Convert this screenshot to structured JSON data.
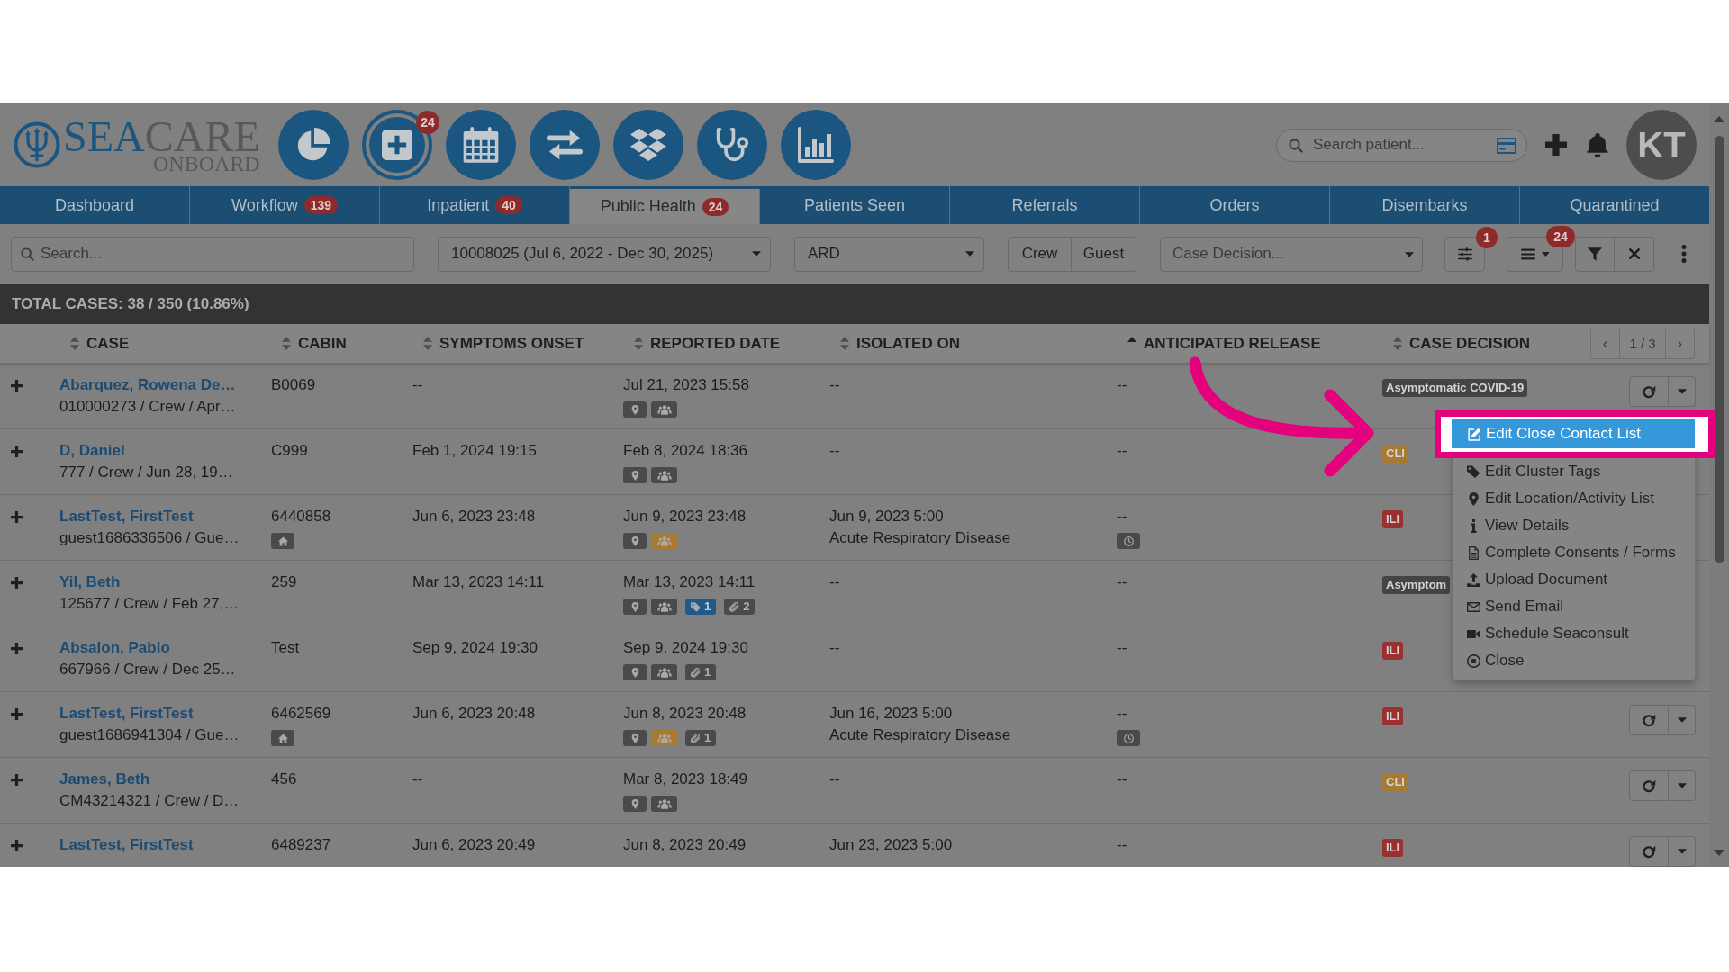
{
  "header": {
    "logo": {
      "primary": "SEA",
      "secondary": "CARE",
      "tagline": "ONBOARD"
    },
    "modules": [
      {
        "selected": false
      },
      {
        "selected": true,
        "badge": "24"
      },
      {
        "selected": false
      },
      {
        "selected": false
      },
      {
        "selected": false
      },
      {
        "selected": false
      },
      {
        "selected": false
      }
    ],
    "patient_search": {
      "placeholder": "Search patient..."
    },
    "avatar": {
      "initials": "KT"
    }
  },
  "tabs": [
    {
      "label": "Dashboard",
      "selected": false
    },
    {
      "label": "Workflow",
      "badge": "139",
      "selected": false
    },
    {
      "label": "Inpatient",
      "badge": "40",
      "selected": false
    },
    {
      "label": "Public Health",
      "badge": "24",
      "selected": true
    },
    {
      "label": "Patients Seen",
      "selected": false
    },
    {
      "label": "Referrals",
      "selected": false
    },
    {
      "label": "Orders",
      "selected": false
    },
    {
      "label": "Disembarks",
      "selected": false
    },
    {
      "label": "Quarantined",
      "selected": false
    }
  ],
  "filters": {
    "search": {
      "placeholder": "Search..."
    },
    "voyage": {
      "value": "10008025 (Jul 6, 2022 - Dec 30, 2025)"
    },
    "category": {
      "value": "ARD"
    },
    "population": [
      {
        "label": "Crew",
        "selected": false
      },
      {
        "label": "Guest",
        "selected": false
      }
    ],
    "case_decision": {
      "placeholder": "Case Decision..."
    },
    "settings_badge": "1",
    "list_badge": "24"
  },
  "summary": "TOTAL CASES: 38 / 350 (10.86%)",
  "table": {
    "columns": [
      {
        "label": "CASE",
        "sorted": false
      },
      {
        "label": "CABIN",
        "sorted": false
      },
      {
        "label": "SYMPTOMS ONSET",
        "sorted": false
      },
      {
        "label": "REPORTED DATE",
        "sorted": false
      },
      {
        "label": "ISOLATED ON",
        "sorted": false
      },
      {
        "label": "ANTICIPATED RELEASE",
        "sorted": true
      },
      {
        "label": "CASE DECISION",
        "sorted": false
      }
    ],
    "pager": {
      "prev": "‹",
      "label": "1 / 3",
      "next": "›"
    },
    "rows": [
      {
        "name": "Abarquez, Rowena De…",
        "details": "010000273 / Crew / Apr…",
        "cabin": "B0069",
        "cabin_home": false,
        "onset": "--",
        "reported": "Jul 21, 2023 15:58",
        "tags": [
          {
            "kind": "location",
            "color": "#4a4a4a"
          },
          {
            "kind": "group",
            "color": "#4a4a4a"
          }
        ],
        "isolated": "--",
        "release": "--",
        "release_timer": false,
        "decision": {
          "text": "Asymptomatic COVID-19",
          "color": "#444444"
        },
        "actions": true
      },
      {
        "name": "D, Daniel",
        "details": "777 / Crew / Jun 28, 19…",
        "cabin": "C999",
        "cabin_home": false,
        "onset": "Feb 1, 2024 19:15",
        "reported": "Feb 8, 2024 18:36",
        "tags": [
          {
            "kind": "location",
            "color": "#4a4a4a"
          },
          {
            "kind": "group",
            "color": "#4a4a4a"
          }
        ],
        "isolated": "--",
        "release": "--",
        "release_timer": false,
        "decision": {
          "text": "CLI",
          "color": "#a67a32"
        },
        "actions": false
      },
      {
        "name": "LastTest, FirstTest",
        "details": "guest1686336506 / Gue…",
        "cabin": "6440858",
        "cabin_home": true,
        "onset": "Jun 6, 2023 23:48",
        "reported": "Jun 9, 2023 23:48",
        "tags": [
          {
            "kind": "location",
            "color": "#4a4a4a"
          },
          {
            "kind": "group",
            "color": "#a67a32"
          }
        ],
        "isolated": "Jun 9, 2023 5:00",
        "isolated_reason": "Acute Respiratory Disease",
        "release": "--",
        "release_timer": true,
        "decision": {
          "text": "ILI",
          "color": "#9b3030"
        },
        "actions": false
      },
      {
        "name": "Yil, Beth",
        "details": "125677 / Crew / Feb 27,…",
        "cabin": "259",
        "cabin_home": false,
        "onset": "Mar 13, 2023 14:11",
        "reported": "Mar 13, 2023 14:11",
        "tags": [
          {
            "kind": "location",
            "color": "#4a4a4a"
          },
          {
            "kind": "group",
            "color": "#4a4a4a"
          },
          {
            "kind": "tag",
            "color": "#1f5a8a",
            "count": "1"
          },
          {
            "kind": "attachment",
            "color": "#4a4a4a",
            "count": "2"
          }
        ],
        "isolated": "--",
        "release": "--",
        "release_timer": false,
        "decision": {
          "text": "Asymptom",
          "color": "#444444"
        },
        "actions": false
      },
      {
        "name": "Absalon, Pablo",
        "details": "667966 / Crew / Dec 25…",
        "cabin": "Test",
        "cabin_home": false,
        "onset": "Sep 9, 2024 19:30",
        "reported": "Sep 9, 2024 19:30",
        "tags": [
          {
            "kind": "location",
            "color": "#4a4a4a"
          },
          {
            "kind": "group",
            "color": "#4a4a4a"
          },
          {
            "kind": "attachment",
            "color": "#4a4a4a",
            "count": "1"
          }
        ],
        "isolated": "--",
        "release": "--",
        "release_timer": false,
        "decision": {
          "text": "ILI",
          "color": "#9b3030"
        },
        "actions": false
      },
      {
        "name": "LastTest, FirstTest",
        "details": "guest1686941304 / Gue…",
        "cabin": "6462569",
        "cabin_home": true,
        "onset": "Jun 6, 2023 20:48",
        "reported": "Jun 8, 2023 20:48",
        "tags": [
          {
            "kind": "location",
            "color": "#4a4a4a"
          },
          {
            "kind": "group",
            "color": "#a67a32"
          },
          {
            "kind": "attachment",
            "color": "#4a4a4a",
            "count": "1"
          }
        ],
        "isolated": "Jun 16, 2023 5:00",
        "isolated_reason": "Acute Respiratory Disease",
        "release": "--",
        "release_timer": true,
        "decision": {
          "text": "ILI",
          "color": "#9b3030"
        },
        "actions": true
      },
      {
        "name": "James, Beth",
        "details": "CM43214321 / Crew / D…",
        "cabin": "456",
        "cabin_home": false,
        "onset": "--",
        "reported": "Mar 8, 2023 18:49",
        "tags": [
          {
            "kind": "location",
            "color": "#4a4a4a"
          },
          {
            "kind": "group",
            "color": "#4a4a4a"
          }
        ],
        "isolated": "--",
        "release": "--",
        "release_timer": false,
        "decision": {
          "text": "CLI",
          "color": "#a67a32"
        },
        "actions": true
      },
      {
        "name": "LastTest, FirstTest",
        "cabin": "6489237",
        "cabin_home": false,
        "onset": "Jun 6, 2023 20:49",
        "reported": "Jun 8, 2023 20:49",
        "isolated": "Jun 23, 2023 5:00",
        "release": "--",
        "release_timer": false,
        "decision": {
          "text": "ILI",
          "color": "#9b3030"
        },
        "actions": true
      }
    ]
  },
  "context_menu": {
    "items": [
      {
        "label": "Edit Close Contact List",
        "selected": true
      },
      {
        "label": "Edit Cluster Tags",
        "selected": false
      },
      {
        "label": "Edit Location/Activity List",
        "selected": false
      },
      {
        "label": "View Details",
        "selected": false
      },
      {
        "label": "Complete Consents / Forms",
        "selected": false
      },
      {
        "label": "Upload Document",
        "selected": false
      },
      {
        "label": "Send Email",
        "selected": false
      },
      {
        "label": "Schedule Seaconsult",
        "selected": false
      },
      {
        "label": "Close",
        "selected": false
      }
    ]
  }
}
